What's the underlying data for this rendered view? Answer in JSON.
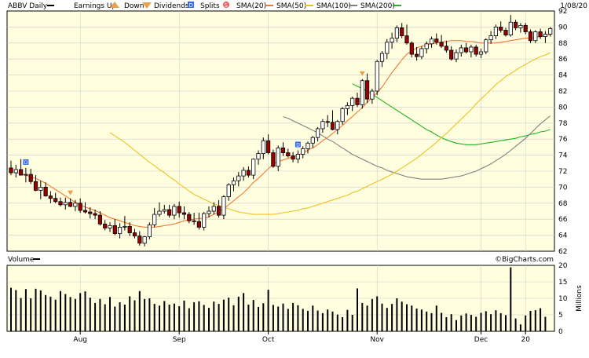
{
  "header": {
    "symbol_label": "ABBV Daily",
    "earnings_label": "Earnings Up",
    "down_label": "Down",
    "dividends_label": "Dividends",
    "dividend_marker": "D",
    "splits_label": "Splits",
    "splits_marker": "S",
    "sma20_label": "SMA(20)",
    "sma50_label": "SMA(50)",
    "sma100_label": "SMA(100)",
    "sma200_label": "SMA(200)",
    "date_label": "1/08/20"
  },
  "volume_header": {
    "label": "Volume"
  },
  "copyright": "©BigCharts.com",
  "colors": {
    "panel_bg": "#ffffe0",
    "grid": "#cccccc",
    "up": "#000000",
    "down": "#990000",
    "sma20": "#f07a35",
    "sma50": "#f0c020",
    "sma100": "#808080",
    "sma200": "#22b422",
    "earnings_marker": "#e8a04c",
    "dividend_marker": "#3366ff",
    "split_marker": "#ff5555"
  },
  "chart_data": [
    {
      "type": "candlestick",
      "ylim": [
        62,
        92
      ],
      "yticks": [
        62,
        64,
        66,
        68,
        70,
        72,
        74,
        76,
        78,
        80,
        82,
        84,
        86,
        88,
        90,
        92
      ],
      "ohlc": [
        [
          72.4,
          73.3,
          71.5,
          71.8
        ],
        [
          71.8,
          72.8,
          71.2,
          72.2
        ],
        [
          72.2,
          73.5,
          71.5,
          71.5
        ],
        [
          71.5,
          72.4,
          70.6,
          71.6
        ],
        [
          71.6,
          72.3,
          70.4,
          70.7
        ],
        [
          70.7,
          71.5,
          69.5,
          69.6
        ],
        [
          69.6,
          70.8,
          68.5,
          70.0
        ],
        [
          70.0,
          70.6,
          68.8,
          68.9
        ],
        [
          68.9,
          69.5,
          68.0,
          68.6
        ],
        [
          68.6,
          69.3,
          68.0,
          68.2
        ],
        [
          68.2,
          68.7,
          67.6,
          67.8
        ],
        [
          67.8,
          68.7,
          67.2,
          68.1
        ],
        [
          68.1,
          68.6,
          67.5,
          67.6
        ],
        [
          67.6,
          68.4,
          67.0,
          68.0
        ],
        [
          68.0,
          68.6,
          66.8,
          67.1
        ],
        [
          67.1,
          68.1,
          66.7,
          66.9
        ],
        [
          66.9,
          67.5,
          66.1,
          66.7
        ],
        [
          66.7,
          67.2,
          66.0,
          66.5
        ],
        [
          66.5,
          67.0,
          65.2,
          65.4
        ],
        [
          65.4,
          65.9,
          64.6,
          64.9
        ],
        [
          64.9,
          65.6,
          64.4,
          65.2
        ],
        [
          65.2,
          66.0,
          64.0,
          64.2
        ],
        [
          64.2,
          65.5,
          63.6,
          65.0
        ],
        [
          65.0,
          66.4,
          64.6,
          65.1
        ],
        [
          65.1,
          65.6,
          63.9,
          64.3
        ],
        [
          64.3,
          64.8,
          63.6,
          63.9
        ],
        [
          63.9,
          64.5,
          62.7,
          63.0
        ],
        [
          63.0,
          63.9,
          62.6,
          63.8
        ],
        [
          63.8,
          65.6,
          63.5,
          65.3
        ],
        [
          65.3,
          67.4,
          65.0,
          66.6
        ],
        [
          66.6,
          68.1,
          66.3,
          67.0
        ],
        [
          67.0,
          67.8,
          66.7,
          67.2
        ],
        [
          67.2,
          67.8,
          66.2,
          66.5
        ],
        [
          66.5,
          67.9,
          66.0,
          67.6
        ],
        [
          67.6,
          68.2,
          66.2,
          66.8
        ],
        [
          66.8,
          67.6,
          66.0,
          66.6
        ],
        [
          66.6,
          66.9,
          65.5,
          65.8
        ],
        [
          65.8,
          66.8,
          65.3,
          65.7
        ],
        [
          65.7,
          66.8,
          64.7,
          65.0
        ],
        [
          65.0,
          66.9,
          64.6,
          66.7
        ],
        [
          66.7,
          67.6,
          66.2,
          67.0
        ],
        [
          67.0,
          68.1,
          66.6,
          67.6
        ],
        [
          67.6,
          68.4,
          66.2,
          66.5
        ],
        [
          66.5,
          69.0,
          66.0,
          68.8
        ],
        [
          68.8,
          70.5,
          68.3,
          70.3
        ],
        [
          70.3,
          71.2,
          69.5,
          70.8
        ],
        [
          70.8,
          71.9,
          70.1,
          71.4
        ],
        [
          71.4,
          72.5,
          70.8,
          72.1
        ],
        [
          72.1,
          72.6,
          71.2,
          71.5
        ],
        [
          71.5,
          73.6,
          71.0,
          73.5
        ],
        [
          73.5,
          74.6,
          72.8,
          74.2
        ],
        [
          74.2,
          76.2,
          73.5,
          75.8
        ],
        [
          75.8,
          76.6,
          74.1,
          74.3
        ],
        [
          74.3,
          74.7,
          72.4,
          72.6
        ],
        [
          72.6,
          75.2,
          72.0,
          74.9
        ],
        [
          74.9,
          75.6,
          73.9,
          74.3
        ],
        [
          74.3,
          74.8,
          73.7,
          73.9
        ],
        [
          73.9,
          74.4,
          73.1,
          73.5
        ],
        [
          73.5,
          74.6,
          73.0,
          74.1
        ],
        [
          74.1,
          75.1,
          73.6,
          74.8
        ],
        [
          74.8,
          75.7,
          74.2,
          75.5
        ],
        [
          75.5,
          76.4,
          74.9,
          76.2
        ],
        [
          76.2,
          77.5,
          75.7,
          77.3
        ],
        [
          77.3,
          78.5,
          76.8,
          78.2
        ],
        [
          78.2,
          79.0,
          77.5,
          78.1
        ],
        [
          78.1,
          79.6,
          77.1,
          77.2
        ],
        [
          77.2,
          78.4,
          76.6,
          78.2
        ],
        [
          78.2,
          80.0,
          77.8,
          79.8
        ],
        [
          79.8,
          80.6,
          79.0,
          80.2
        ],
        [
          80.2,
          81.3,
          79.5,
          81.1
        ],
        [
          81.1,
          81.8,
          80.0,
          80.3
        ],
        [
          80.3,
          83.5,
          79.8,
          83.3
        ],
        [
          83.3,
          84.2,
          80.5,
          81.0
        ],
        [
          81.0,
          82.3,
          80.4,
          82.0
        ],
        [
          82.0,
          85.9,
          81.5,
          85.7
        ],
        [
          85.7,
          87.0,
          85.0,
          86.7
        ],
        [
          86.7,
          88.5,
          86.0,
          88.1
        ],
        [
          88.1,
          89.3,
          87.3,
          88.6
        ],
        [
          88.6,
          90.2,
          88.1,
          89.9
        ],
        [
          89.9,
          90.5,
          88.6,
          88.9
        ],
        [
          88.9,
          90.3,
          87.8,
          88.0
        ],
        [
          88.0,
          88.2,
          86.2,
          86.6
        ],
        [
          86.6,
          87.5,
          85.8,
          86.3
        ],
        [
          86.3,
          87.6,
          86.0,
          87.3
        ],
        [
          87.3,
          88.2,
          86.7,
          87.9
        ],
        [
          87.9,
          88.8,
          87.4,
          88.5
        ],
        [
          88.5,
          89.2,
          87.8,
          88.1
        ],
        [
          88.1,
          89.0,
          87.4,
          87.6
        ],
        [
          87.6,
          88.3,
          86.8,
          87.1
        ],
        [
          87.1,
          87.6,
          85.8,
          86.0
        ],
        [
          86.0,
          87.2,
          85.6,
          86.8
        ],
        [
          86.8,
          87.8,
          86.3,
          87.4
        ],
        [
          87.4,
          88.0,
          86.7,
          86.9
        ],
        [
          86.9,
          87.8,
          86.2,
          87.5
        ],
        [
          87.5,
          87.8,
          86.3,
          86.6
        ],
        [
          86.6,
          87.3,
          86.1,
          86.9
        ],
        [
          86.9,
          88.6,
          86.6,
          88.4
        ],
        [
          88.4,
          89.5,
          87.9,
          88.9
        ],
        [
          88.9,
          90.3,
          88.5,
          90.0
        ],
        [
          90.0,
          90.7,
          89.3,
          89.6
        ],
        [
          89.6,
          89.9,
          88.8,
          89.0
        ],
        [
          89.0,
          91.5,
          88.8,
          90.6
        ],
        [
          90.6,
          90.9,
          89.6,
          89.9
        ],
        [
          89.9,
          90.5,
          89.3,
          90.2
        ],
        [
          90.2,
          90.5,
          89.1,
          89.4
        ],
        [
          89.4,
          89.7,
          88.0,
          88.3
        ],
        [
          88.3,
          89.6,
          88.0,
          89.4
        ],
        [
          89.4,
          89.8,
          88.5,
          88.8
        ],
        [
          88.8,
          89.5,
          88.0,
          89.1
        ],
        [
          89.1,
          90.0,
          88.8,
          89.8
        ]
      ],
      "sma20": [
        71.8,
        71.7,
        71.5,
        71.3,
        71.1,
        70.8,
        70.5,
        70.1,
        69.7,
        69.3,
        68.9,
        68.5,
        68.1,
        67.8,
        67.5,
        67.3,
        67.1,
        66.8,
        66.5,
        66.2,
        66.0,
        65.8,
        65.6,
        65.4,
        65.2,
        65.1,
        65.0,
        65.0,
        65.0,
        65.1,
        65.2,
        65.3,
        65.4,
        65.6,
        65.8,
        65.9,
        66.0,
        66.1,
        66.1,
        66.3,
        66.6,
        67.0,
        67.3,
        67.8,
        68.3,
        68.8,
        69.3,
        69.9,
        70.6,
        71.1,
        71.7,
        72.3,
        72.9,
        73.2,
        73.4,
        73.6,
        73.8,
        74.0,
        74.3,
        74.6,
        74.9,
        75.3,
        75.8,
        76.2,
        76.7,
        77.2,
        77.7,
        78.3,
        78.8,
        79.4,
        79.9,
        80.6,
        81.2,
        81.8,
        82.5,
        83.4,
        84.3,
        85.1,
        85.9,
        86.6,
        87.0,
        87.4,
        87.6,
        87.8,
        87.9,
        88.0,
        88.1,
        88.2,
        88.3,
        88.3,
        88.3,
        88.2,
        88.2,
        88.1,
        88.0,
        88.0,
        88.0,
        88.0,
        88.1,
        88.2,
        88.3,
        88.4,
        88.5,
        88.6,
        88.6,
        88.7,
        88.8,
        88.9,
        89.1
      ],
      "sma50": [
        76.8,
        76.4,
        76.0,
        75.6,
        75.1,
        74.6,
        74.1,
        73.6,
        73.1,
        72.7,
        72.2,
        71.8,
        71.3,
        70.9,
        70.4,
        70.0,
        69.5,
        69.1,
        68.8,
        68.5,
        68.2,
        67.9,
        67.7,
        67.5,
        67.3,
        67.1,
        66.9,
        66.8,
        66.7,
        66.6,
        66.6,
        66.6,
        66.6,
        66.6,
        66.7,
        66.8,
        66.9,
        67.0,
        67.1,
        67.3,
        67.4,
        67.6,
        67.8,
        68.0,
        68.2,
        68.4,
        68.6,
        68.8,
        69.0,
        69.3,
        69.5,
        69.8,
        70.1,
        70.4,
        70.7,
        71.0,
        71.3,
        71.6,
        72.0,
        72.4,
        72.8,
        73.2,
        73.6,
        74.1,
        74.6,
        75.1,
        75.6,
        76.2,
        76.7,
        77.3,
        77.9,
        78.5,
        79.1,
        79.7,
        80.4,
        81.0,
        81.6,
        82.2,
        82.8,
        83.3,
        83.8,
        84.2,
        84.6,
        85.0,
        85.3,
        85.7,
        86.0,
        86.3,
        86.5,
        86.8
      ],
      "sma100": [
        78.8,
        78.6,
        78.3,
        78.0,
        77.7,
        77.4,
        77.1,
        76.8,
        76.4,
        76.0,
        75.7,
        75.3,
        74.9,
        74.5,
        74.1,
        73.8,
        73.5,
        73.2,
        72.9,
        72.6,
        72.4,
        72.1,
        71.9,
        71.7,
        71.5,
        71.3,
        71.2,
        71.1,
        71.0,
        71.0,
        71.0,
        71.0,
        71.0,
        71.1,
        71.2,
        71.3,
        71.4,
        71.6,
        71.8,
        72.0,
        72.3,
        72.6,
        72.9,
        73.3,
        73.7,
        74.1,
        74.6,
        75.1,
        75.6,
        76.1,
        76.7,
        77.3,
        77.9,
        78.4,
        78.9
      ],
      "sma200": [
        82.9,
        82.6,
        82.3,
        82.0,
        81.6,
        81.2,
        80.8,
        80.4,
        80.0,
        79.6,
        79.2,
        78.8,
        78.4,
        78.0,
        77.6,
        77.2,
        76.9,
        76.5,
        76.2,
        75.9,
        75.7,
        75.5,
        75.4,
        75.3,
        75.3,
        75.3,
        75.4,
        75.5,
        75.6,
        75.7,
        75.8,
        75.9,
        76.0,
        76.1,
        76.3,
        76.4,
        76.6,
        76.7,
        76.9,
        77.0,
        77.2
      ]
    },
    {
      "type": "bar",
      "series": [
        {
          "values": [
            13.2,
            12.5,
            10.1,
            12.8,
            10.0,
            12.9,
            12.4,
            11.0,
            10.5,
            9.6,
            12.2,
            11.3,
            10.4,
            9.8,
            11.6,
            12.1,
            10.2,
            8.6,
            9.8,
            8.2,
            10.4,
            7.5,
            8.8,
            8.1,
            10.6,
            9.4,
            12.2,
            9.8,
            10.0,
            8.3,
            7.8,
            9.2,
            8.1,
            8.4,
            7.6,
            9.3,
            7.0,
            8.8,
            9.1,
            8.0,
            7.1,
            9.0,
            8.3,
            9.6,
            10.2,
            7.9,
            10.5,
            11.6,
            8.1,
            9.5,
            7.4,
            8.5,
            12.6,
            8.0,
            7.5,
            8.4,
            6.8,
            8.6,
            7.9,
            6.8,
            6.2,
            7.8,
            6.3,
            5.5,
            6.6,
            6.0,
            5.1,
            4.3,
            6.5,
            5.0,
            13.0,
            8.6,
            7.8,
            9.8,
            10.6,
            8.4,
            7.1,
            8.3,
            10.0,
            9.0,
            8.2,
            7.8,
            6.9,
            6.6,
            6.0,
            5.5,
            7.8,
            5.6,
            4.3,
            5.2,
            3.4,
            4.8,
            5.4,
            5.0,
            4.4,
            5.6,
            6.1,
            5.2,
            6.4,
            5.5,
            4.9,
            19.4,
            3.9,
            2.1,
            4.8,
            6.2,
            6.4,
            7.0,
            4.4
          ]
        }
      ],
      "ylim": [
        0,
        20
      ],
      "yticks": [
        0,
        5,
        10,
        15,
        20
      ],
      "ylabel": "Millions"
    }
  ],
  "xaxis": {
    "labels": [
      "Aug",
      "Sep",
      "Oct",
      "Nov",
      "Dec",
      "20"
    ],
    "label_bars": [
      14,
      34,
      52,
      74,
      95,
      104
    ]
  },
  "markers": {
    "earnings_bars": [
      12,
      71
    ],
    "dividend_bars": [
      3,
      58
    ]
  }
}
